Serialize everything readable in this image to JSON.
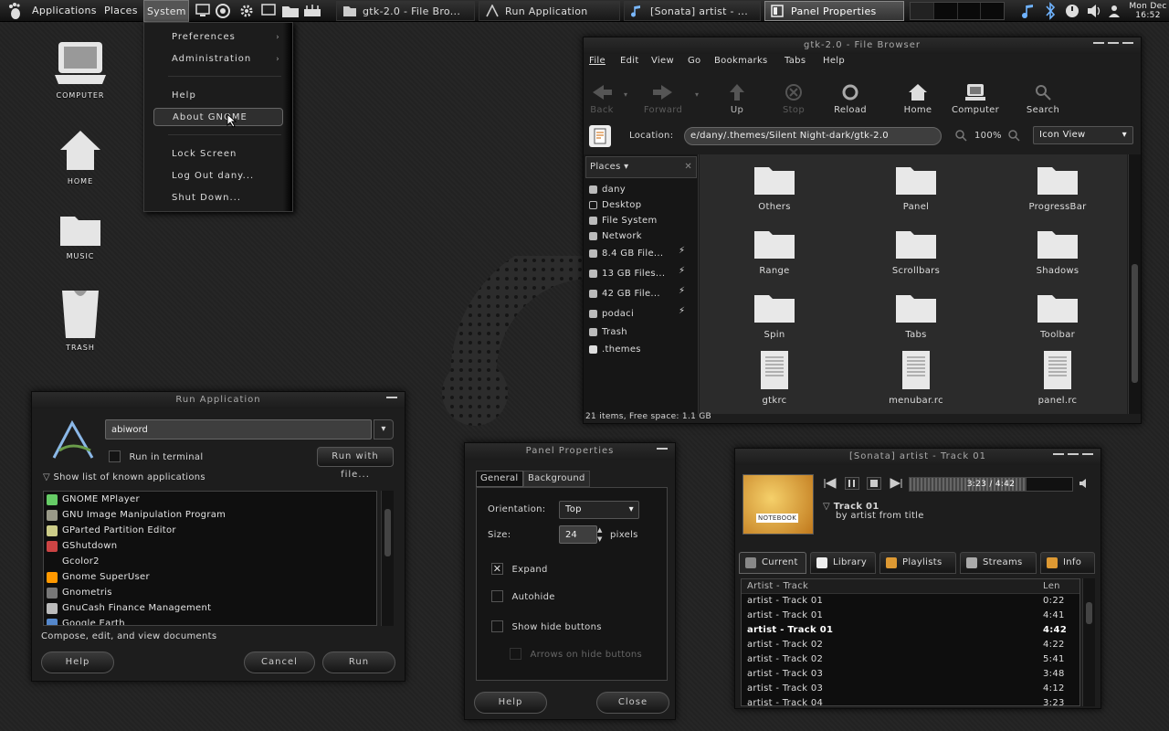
{
  "panel": {
    "menus": [
      "Applications",
      "Places",
      "System"
    ],
    "tasks": [
      {
        "label": "gtk-2.0 - File Bro...",
        "icon": "folder-icon"
      },
      {
        "label": "Run Application",
        "icon": "run-icon"
      },
      {
        "label": "[Sonata] artist - ...",
        "icon": "music-note-icon"
      },
      {
        "label": "Panel Properties",
        "icon": "panel-icon"
      }
    ],
    "clock": {
      "day": "Mon Dec",
      "time": "16:52"
    }
  },
  "desktop": {
    "icons": [
      "COMPUTER",
      "HOME",
      "MUSIC",
      "TRASH"
    ]
  },
  "system_menu": {
    "items": [
      "Preferences",
      "Administration",
      "Help",
      "About GNOME",
      "Lock Screen",
      "Log Out dany...",
      "Shut Down..."
    ]
  },
  "file_browser": {
    "title": "gtk-2.0 - File Browser",
    "menu": [
      "File",
      "Edit",
      "View",
      "Go",
      "Bookmarks",
      "Tabs",
      "Help"
    ],
    "toolbar": [
      "Back",
      "Forward",
      "Up",
      "Stop",
      "Reload",
      "Home",
      "Computer",
      "Search"
    ],
    "location_label": "Location:",
    "location_value": "e/dany/.themes/Silent Night-dark/gtk-2.0",
    "zoom": "100%",
    "view_mode": "Icon View",
    "places_label": "Places",
    "places": [
      "dany",
      "Desktop",
      "File System",
      "Network",
      "8.4 GB File...",
      "13 GB Files...",
      "42 GB File...",
      "podaci",
      "Trash",
      ".themes"
    ],
    "items": [
      "Others",
      "Panel",
      "ProgressBar",
      "Range",
      "Scrollbars",
      "Shadows",
      "Spin",
      "Tabs",
      "Toolbar",
      "gtkrc",
      "menubar.rc",
      "panel.rc"
    ],
    "status": "21 items, Free space: 1.1 GB"
  },
  "run_app": {
    "title": "Run Application",
    "command": "abiword",
    "run_in_terminal": "Run in terminal",
    "run_with_file": "Run with file...",
    "show_list": "Show list of known applications",
    "apps": [
      "GNOME MPlayer",
      "GNU Image Manipulation Program",
      "GParted Partition Editor",
      "GShutdown",
      "Gcolor2",
      "Gnome SuperUser",
      "Gnometris",
      "GnuCash Finance Management",
      "Google Earth"
    ],
    "description": "Compose, edit, and view documents",
    "help": "Help",
    "cancel": "Cancel",
    "run": "Run"
  },
  "panel_props": {
    "title": "Panel Properties",
    "tabs": [
      "General",
      "Background"
    ],
    "orientation_label": "Orientation:",
    "orientation_value": "Top",
    "size_label": "Size:",
    "size_value": "24",
    "size_unit": "pixels",
    "expand": "Expand",
    "autohide": "Autohide",
    "show_hide": "Show hide buttons",
    "arrows": "Arrows on hide buttons",
    "help": "Help",
    "close": "Close"
  },
  "sonata": {
    "title": "[Sonata] artist - Track 01",
    "time": "3:23 / 4:42",
    "progress": 0.72,
    "track": "Track 01",
    "subtitle": "by artist from title",
    "album_text": "NOTEBOOK",
    "tabs": [
      "Current",
      "Library",
      "Playlists",
      "Streams",
      "Info"
    ],
    "columns": [
      "Artist - Track",
      "Len"
    ],
    "rows": [
      [
        "artist - Track 01",
        "0:22"
      ],
      [
        "artist - Track 01",
        "4:41"
      ],
      [
        "artist - Track 01",
        "4:42"
      ],
      [
        "artist - Track 02",
        "4:22"
      ],
      [
        "artist - Track 02",
        "5:41"
      ],
      [
        "artist - Track 03",
        "3:48"
      ],
      [
        "artist - Track 03",
        "4:12"
      ],
      [
        "artist - Track 04",
        "3:23"
      ]
    ]
  }
}
